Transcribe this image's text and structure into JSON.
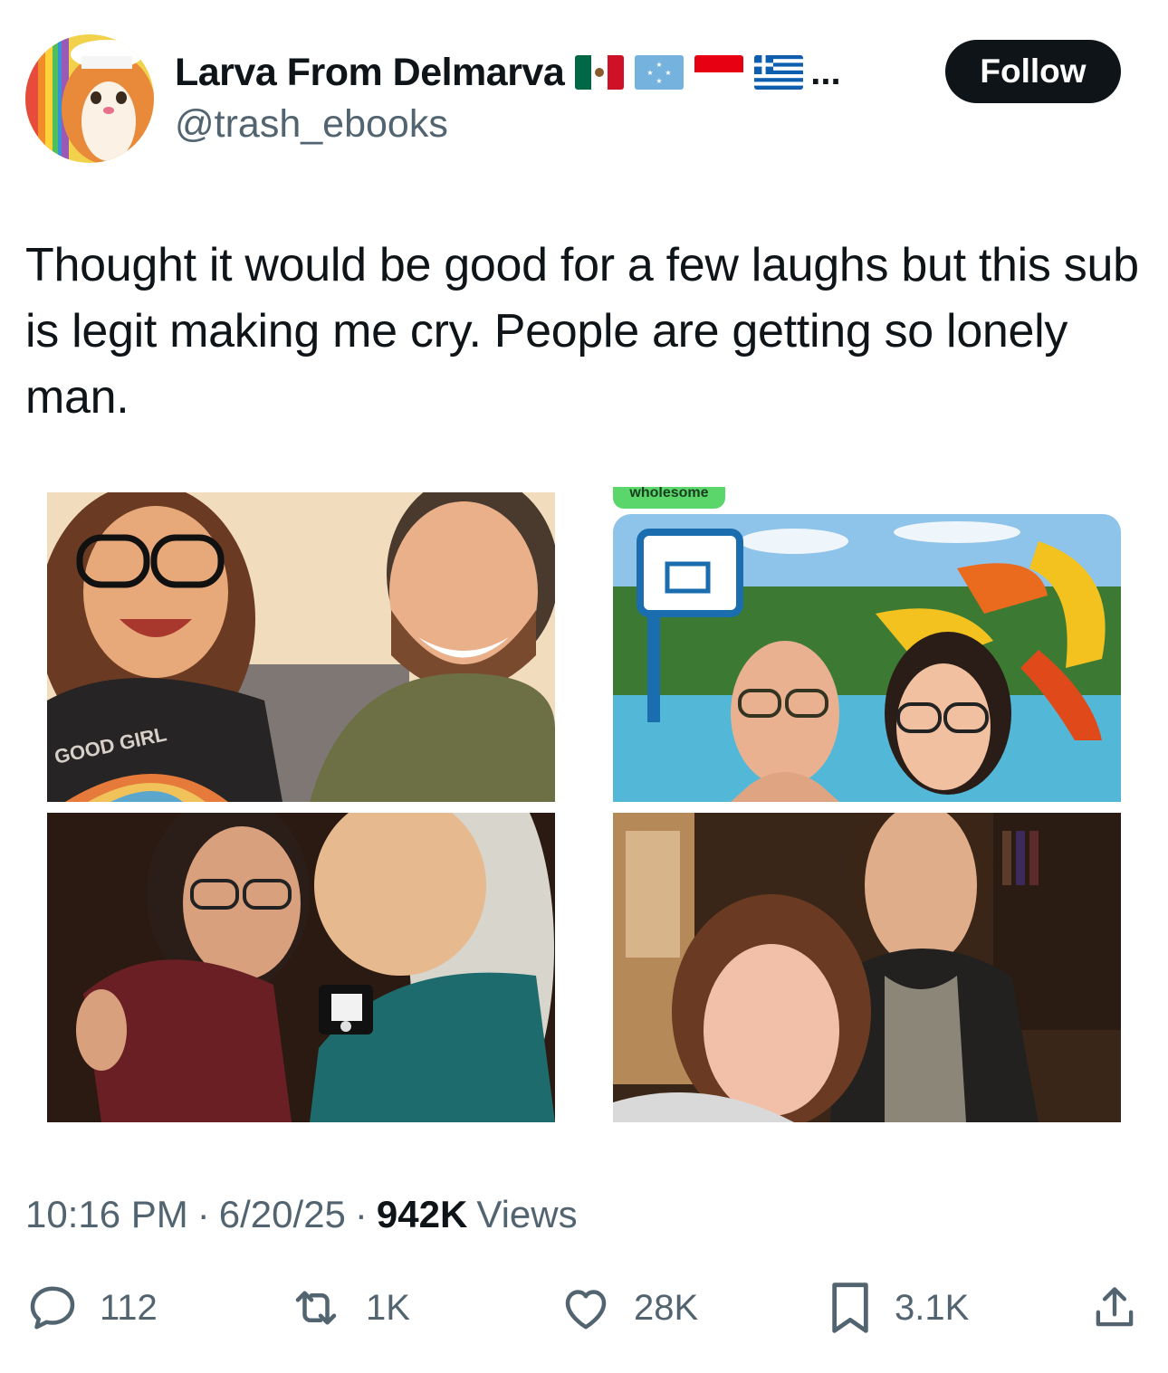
{
  "author": {
    "display_name": "Larva From Delmarva",
    "handle": "@trash_ebooks",
    "flags": [
      "mexico-flag",
      "micronesia-flag",
      "indonesia-flag",
      "greece-flag"
    ],
    "flags_overflow": "...",
    "follow_label": "Follow"
  },
  "tweet": {
    "text": "Thought it would be good for a few laughs but this sub is legit making me cry. People are getting so lonely man.",
    "media_tag": "wholesome"
  },
  "meta": {
    "time": "10:16 PM",
    "sep1": "·",
    "date": "6/20/25",
    "sep2": "·",
    "views_count": "942K",
    "views_label": "Views"
  },
  "actions": {
    "replies": "112",
    "reposts": "1K",
    "likes": "28K",
    "bookmarks": "3.1K"
  },
  "colors": {
    "follow_bg": "#0f1419",
    "secondary_text": "#536471",
    "tag_green": "#5bd66b"
  }
}
